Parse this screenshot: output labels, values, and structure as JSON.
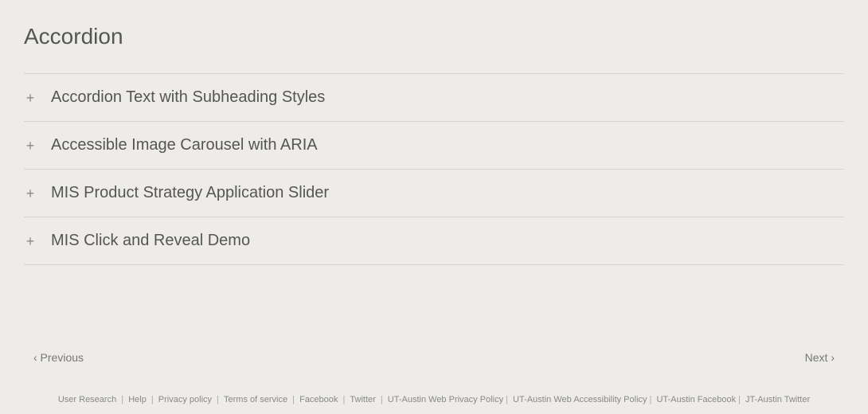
{
  "page": {
    "title": "Accordion",
    "bg_color": "#eeece8"
  },
  "accordion": {
    "items": [
      {
        "label": "Accordion Text with Subheading Styles"
      },
      {
        "label": "Accessible Image Carousel with ARIA"
      },
      {
        "label": "MIS Product Strategy Application Slider"
      },
      {
        "label": "MIS Click and Reveal Demo"
      }
    ],
    "plus_symbol": "+"
  },
  "pagination": {
    "previous_label": "‹ Previous",
    "next_label": "Next ›"
  },
  "footer": {
    "links": [
      "User Research",
      "Help",
      "Privacy policy",
      "Terms of service",
      "Facebook",
      "Twitter",
      "UT-Austin Web Privacy Policy",
      "UT-Austin Web Accessibility Policy",
      "UT-Austin Facebook",
      "JT-Austin Twitter"
    ]
  }
}
